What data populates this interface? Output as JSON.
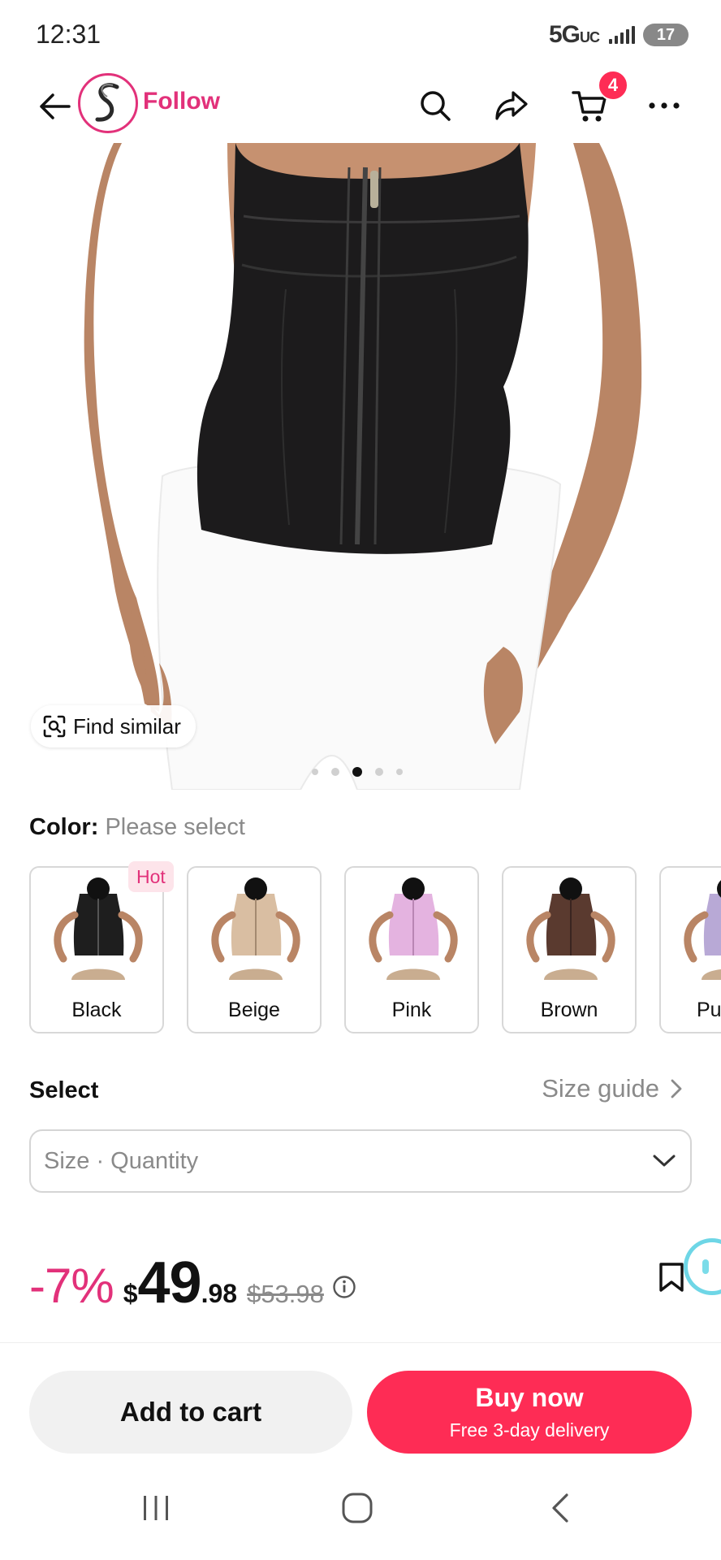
{
  "status_bar": {
    "time": "12:31",
    "network": "5G",
    "network_suffix": "UC",
    "battery": "17"
  },
  "header": {
    "follow_label": "Follow",
    "cart_count": "4",
    "icons": [
      "back-arrow-icon",
      "store-logo",
      "search-icon",
      "share-icon",
      "cart-icon",
      "more-icon"
    ]
  },
  "gallery": {
    "find_similar_label": "Find similar",
    "image_count": 5,
    "active_index": 2
  },
  "color": {
    "label": "Color:",
    "value": "Please select",
    "hot_badge": "Hot",
    "options": [
      {
        "name": "Black",
        "hex": "#1e1e1e"
      },
      {
        "name": "Beige",
        "hex": "#d9bea2"
      },
      {
        "name": "Pink",
        "hex": "#e4b3e0"
      },
      {
        "name": "Brown",
        "hex": "#5a3a2f"
      },
      {
        "name": "Pu",
        "hex": "#b8a9d6"
      }
    ]
  },
  "select": {
    "title": "Select",
    "size_guide": "Size guide",
    "placeholder": "Size · Quantity"
  },
  "price": {
    "discount": "-7%",
    "currency": "$",
    "main": "49",
    "cents": ".98",
    "original": "$53.98"
  },
  "actions": {
    "add_to_cart": "Add to cart",
    "buy_now": "Buy now",
    "buy_now_sub": "Free 3-day delivery"
  },
  "colors": {
    "accent": "#fe2c55",
    "brand_pink": "#e2317a",
    "muted_text": "#8a8a8a"
  }
}
